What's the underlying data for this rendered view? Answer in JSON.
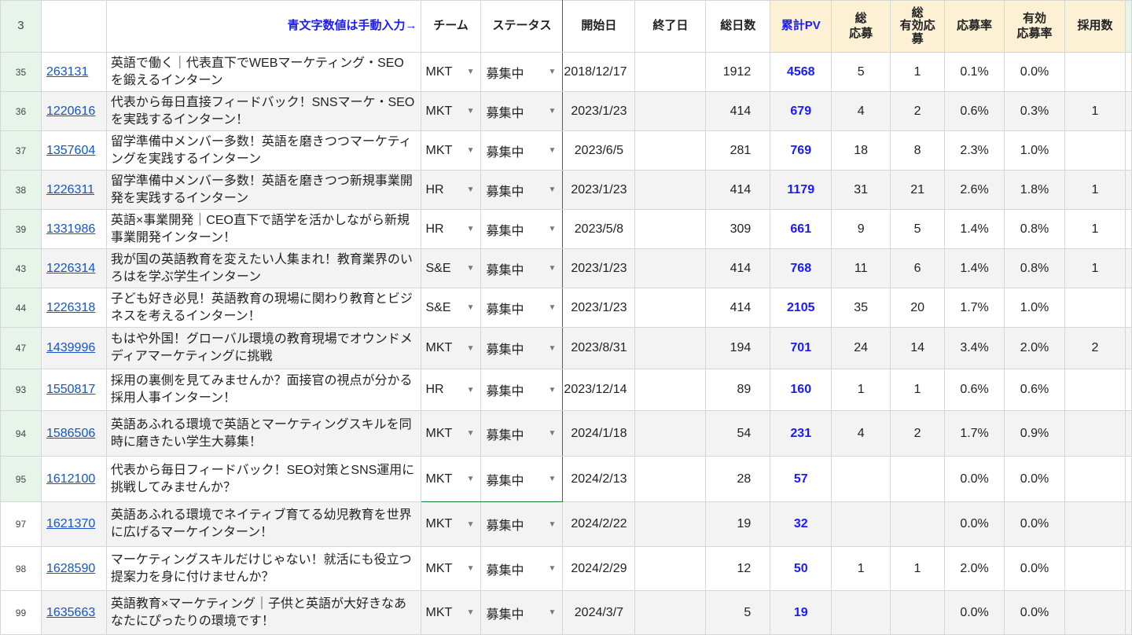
{
  "header": {
    "row_number": "3",
    "note": "青文字数値は手動入力→",
    "team": "チーム",
    "status": "ステータス",
    "start": "開始日",
    "end": "終了日",
    "days": "総日数",
    "pv": "累計PV",
    "apps": "総\n応募",
    "valid_apps": "総\n有効応\n募",
    "rate": "応募率",
    "valid_rate": "有効\n応募率",
    "hires": "採用数"
  },
  "rows": [
    {
      "n": "35",
      "id": "263131",
      "title": "英語で働く｜代表直下でWEBマーケティング・SEOを鍛えるインターン",
      "team": "MKT",
      "status": "募集中",
      "start": "2018/12/17",
      "end": "",
      "days": "1912",
      "pv": "4568",
      "apps": "5",
      "valid": "1",
      "rate": "0.1%",
      "vrate": "0.0%",
      "hires": ""
    },
    {
      "n": "36",
      "id": "1220616",
      "title": "代表から毎日直接フィードバック！SNSマーケ・SEOを実践するインターン！",
      "team": "MKT",
      "status": "募集中",
      "start": "2023/1/23",
      "end": "",
      "days": "414",
      "pv": "679",
      "apps": "4",
      "valid": "2",
      "rate": "0.6%",
      "vrate": "0.3%",
      "hires": "1"
    },
    {
      "n": "37",
      "id": "1357604",
      "title": "留学準備中メンバー多数！英語を磨きつつマーケティングを実践するインターン",
      "team": "MKT",
      "status": "募集中",
      "start": "2023/6/5",
      "end": "",
      "days": "281",
      "pv": "769",
      "apps": "18",
      "valid": "8",
      "rate": "2.3%",
      "vrate": "1.0%",
      "hires": ""
    },
    {
      "n": "38",
      "id": "1226311",
      "title": "留学準備中メンバー多数！英語を磨きつつ新規事業開発を実践するインターン",
      "team": "HR",
      "status": "募集中",
      "start": "2023/1/23",
      "end": "",
      "days": "414",
      "pv": "1179",
      "apps": "31",
      "valid": "21",
      "rate": "2.6%",
      "vrate": "1.8%",
      "hires": "1"
    },
    {
      "n": "39",
      "id": "1331986",
      "title": "英語×事業開発｜CEO直下で語学を活かしながら新規事業開発インターン！",
      "team": "HR",
      "status": "募集中",
      "start": "2023/5/8",
      "end": "",
      "days": "309",
      "pv": "661",
      "apps": "9",
      "valid": "5",
      "rate": "1.4%",
      "vrate": "0.8%",
      "hires": "1"
    },
    {
      "n": "43",
      "id": "1226314",
      "title": "我が国の英語教育を変えたい人集まれ！教育業界のいろはを学ぶ学生インターン",
      "team": "S&E",
      "status": "募集中",
      "start": "2023/1/23",
      "end": "",
      "days": "414",
      "pv": "768",
      "apps": "11",
      "valid": "6",
      "rate": "1.4%",
      "vrate": "0.8%",
      "hires": "1"
    },
    {
      "n": "44",
      "id": "1226318",
      "title": "子ども好き必見！英語教育の現場に関わり教育とビジネスを考えるインターン！",
      "team": "S&E",
      "status": "募集中",
      "start": "2023/1/23",
      "end": "",
      "days": "414",
      "pv": "2105",
      "apps": "35",
      "valid": "20",
      "rate": "1.7%",
      "vrate": "1.0%",
      "hires": ""
    },
    {
      "n": "47",
      "id": "1439996",
      "title": "もはや外国！グローバル環境の教育現場でオウンドメディアマーケティングに挑戦",
      "team": "MKT",
      "status": "募集中",
      "start": "2023/8/31",
      "end": "",
      "days": "194",
      "pv": "701",
      "apps": "24",
      "valid": "14",
      "rate": "3.4%",
      "vrate": "2.0%",
      "hires": "2"
    },
    {
      "n": "93",
      "id": "1550817",
      "title": "採用の裏側を見てみませんか？面接官の視点が分かる採用人事インターン！",
      "team": "HR",
      "status": "募集中",
      "start": "2023/12/14",
      "end": "",
      "days": "89",
      "pv": "160",
      "apps": "1",
      "valid": "1",
      "rate": "0.6%",
      "vrate": "0.6%",
      "hires": ""
    },
    {
      "n": "94",
      "id": "1586506",
      "title": "英語あふれる環境で英語とマーケティングスキルを同時に磨きたい学生大募集！",
      "team": "MKT",
      "status": "募集中",
      "start": "2024/1/18",
      "end": "",
      "days": "54",
      "pv": "231",
      "apps": "4",
      "valid": "2",
      "rate": "1.7%",
      "vrate": "0.9%",
      "hires": ""
    },
    {
      "n": "95",
      "id": "1612100",
      "title": "代表から毎日フィードバック！SEO対策とSNS運用に挑戦してみませんか？",
      "team": "MKT",
      "status": "募集中",
      "start": "2024/2/13",
      "end": "",
      "days": "28",
      "pv": "57",
      "apps": "",
      "valid": "",
      "rate": "0.0%",
      "vrate": "0.0%",
      "hires": ""
    },
    {
      "n": "97",
      "id": "1621370",
      "title": "英語あふれる環境でネイティブ育てる幼児教育を世界に広げるマーケインターン！",
      "team": "MKT",
      "status": "募集中",
      "start": "2024/2/22",
      "end": "",
      "days": "19",
      "pv": "32",
      "apps": "",
      "valid": "",
      "rate": "0.0%",
      "vrate": "0.0%",
      "hires": ""
    },
    {
      "n": "98",
      "id": "1628590",
      "title": "マーケティングスキルだけじゃない！就活にも役立つ提案力を身に付けませんか？",
      "team": "MKT",
      "status": "募集中",
      "start": "2024/2/29",
      "end": "",
      "days": "12",
      "pv": "50",
      "apps": "1",
      "valid": "1",
      "rate": "2.0%",
      "vrate": "0.0%",
      "hires": ""
    },
    {
      "n": "99",
      "id": "1635663",
      "title": "英語教育×マーケティング｜子供と英語が大好きなあなたにぴったりの環境です！",
      "team": "MKT",
      "status": "募集中",
      "start": "2024/3/7",
      "end": "",
      "days": "5",
      "pv": "19",
      "apps": "",
      "valid": "",
      "rate": "0.0%",
      "vrate": "0.0%",
      "hires": ""
    }
  ]
}
